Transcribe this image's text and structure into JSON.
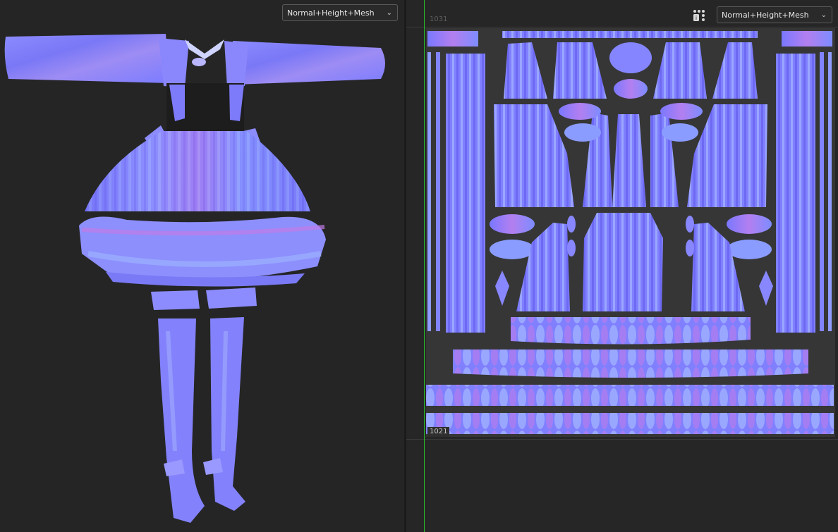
{
  "viewport3d": {
    "channel_select": "Normal+Height+Mesh",
    "chevron_icon": "chevron-down-icon"
  },
  "uv_editor": {
    "channel_select": "Normal+Height+Mesh",
    "grid_icon": "grid-dots-icon",
    "tile_label_top": "1031",
    "tile_label_bottom": "1021"
  },
  "colors": {
    "normal_base": "#7f7fff",
    "normal_light": "#a4b6ff",
    "normal_pink": "#c178e8",
    "normal_deep": "#6d66f0",
    "background": "#252525",
    "axis_green": "#29c12a"
  }
}
